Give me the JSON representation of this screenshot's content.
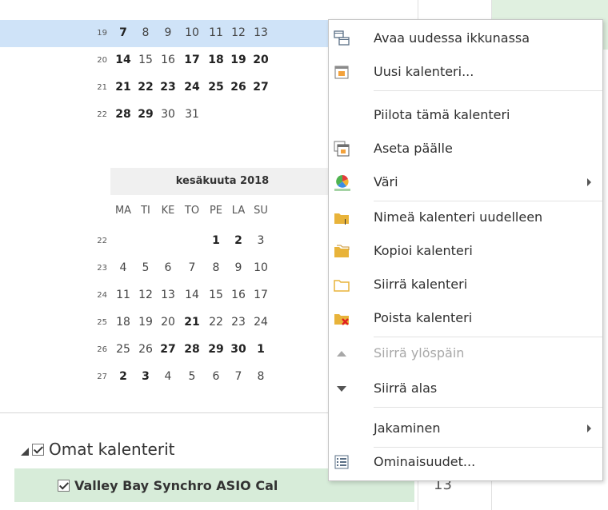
{
  "may_calendar": {
    "weeks": [
      {
        "wk": "19",
        "days": [
          {
            "t": "7",
            "b": true
          },
          {
            "t": "8"
          },
          {
            "t": "9"
          },
          {
            "t": "10"
          },
          {
            "t": "11"
          },
          {
            "t": "12"
          },
          {
            "t": "13"
          }
        ],
        "highlight": true
      },
      {
        "wk": "20",
        "days": [
          {
            "t": "14",
            "b": true
          },
          {
            "t": "15"
          },
          {
            "t": "16"
          },
          {
            "t": "17",
            "b": true
          },
          {
            "t": "18",
            "b": true
          },
          {
            "t": "19",
            "b": true
          },
          {
            "t": "20",
            "b": true
          }
        ]
      },
      {
        "wk": "21",
        "days": [
          {
            "t": "21",
            "b": true
          },
          {
            "t": "22",
            "b": true
          },
          {
            "t": "23",
            "b": true
          },
          {
            "t": "24",
            "b": true
          },
          {
            "t": "25",
            "b": true
          },
          {
            "t": "26",
            "b": true
          },
          {
            "t": "27",
            "b": true
          }
        ]
      },
      {
        "wk": "22",
        "days": [
          {
            "t": "28",
            "b": true
          },
          {
            "t": "29",
            "b": true
          },
          {
            "t": "30"
          },
          {
            "t": "31"
          },
          {
            "t": ""
          },
          {
            "t": ""
          },
          {
            "t": ""
          }
        ]
      }
    ]
  },
  "june_calendar": {
    "title": "kesäkuuta 2018",
    "dow": [
      "MA",
      "TI",
      "KE",
      "TO",
      "PE",
      "LA",
      "SU"
    ],
    "weeks": [
      {
        "wk": "22",
        "days": [
          {
            "t": ""
          },
          {
            "t": ""
          },
          {
            "t": ""
          },
          {
            "t": ""
          },
          {
            "t": "1",
            "b": true
          },
          {
            "t": "2",
            "b": true
          },
          {
            "t": "3"
          }
        ]
      },
      {
        "wk": "23",
        "days": [
          {
            "t": "4"
          },
          {
            "t": "5"
          },
          {
            "t": "6"
          },
          {
            "t": "7"
          },
          {
            "t": "8"
          },
          {
            "t": "9"
          },
          {
            "t": "10"
          }
        ]
      },
      {
        "wk": "24",
        "days": [
          {
            "t": "11"
          },
          {
            "t": "12"
          },
          {
            "t": "13"
          },
          {
            "t": "14"
          },
          {
            "t": "15"
          },
          {
            "t": "16"
          },
          {
            "t": "17"
          }
        ]
      },
      {
        "wk": "25",
        "days": [
          {
            "t": "18"
          },
          {
            "t": "19"
          },
          {
            "t": "20"
          },
          {
            "t": "21",
            "b": true
          },
          {
            "t": "22"
          },
          {
            "t": "23"
          },
          {
            "t": "24"
          }
        ]
      },
      {
        "wk": "26",
        "days": [
          {
            "t": "25"
          },
          {
            "t": "26"
          },
          {
            "t": "27",
            "b": true
          },
          {
            "t": "28",
            "b": true
          },
          {
            "t": "29",
            "b": true
          },
          {
            "t": "30",
            "b": true
          },
          {
            "t": "1",
            "b": true
          }
        ]
      },
      {
        "wk": "27",
        "days": [
          {
            "t": "2",
            "b": true
          },
          {
            "t": "3",
            "b": true
          },
          {
            "t": "4"
          },
          {
            "t": "5"
          },
          {
            "t": "6"
          },
          {
            "t": "7"
          },
          {
            "t": "8"
          }
        ]
      }
    ]
  },
  "folders": {
    "group_label": "Omat kalenterit",
    "calendar_label": "Valley Bay Synchro ASIO Cal"
  },
  "background": {
    "day_number": "13"
  },
  "menu": {
    "items": [
      {
        "label": "Avaa uudessa ikkunassa",
        "icon": "new-window-icon"
      },
      {
        "label": "Uusi kalenteri...",
        "icon": "new-calendar-icon"
      },
      {
        "label": "Piilota tämä kalenteri",
        "icon": ""
      },
      {
        "label": "Aseta päälle",
        "icon": "overlay-icon"
      },
      {
        "label": "Väri",
        "icon": "color-wheel-icon",
        "submenu": true
      },
      {
        "label": "Nimeä kalenteri uudelleen",
        "icon": "rename-folder-icon"
      },
      {
        "label": "Kopioi kalenteri",
        "icon": "copy-folder-icon"
      },
      {
        "label": "Siirrä kalenteri",
        "icon": "move-folder-icon"
      },
      {
        "label": "Poista kalenteri",
        "icon": "delete-folder-icon"
      },
      {
        "label": "Siirrä ylöspäin",
        "icon": "arrow-up-icon",
        "disabled": true
      },
      {
        "label": "Siirrä alas",
        "icon": "arrow-down-icon"
      },
      {
        "label": "Jakaminen",
        "icon": "",
        "submenu": true
      },
      {
        "label": "Ominaisuudet...",
        "icon": "properties-icon"
      }
    ],
    "colors": {
      "folder": "#e8b33a",
      "delete": "#e02020",
      "accent": "#2a6fb8"
    }
  }
}
